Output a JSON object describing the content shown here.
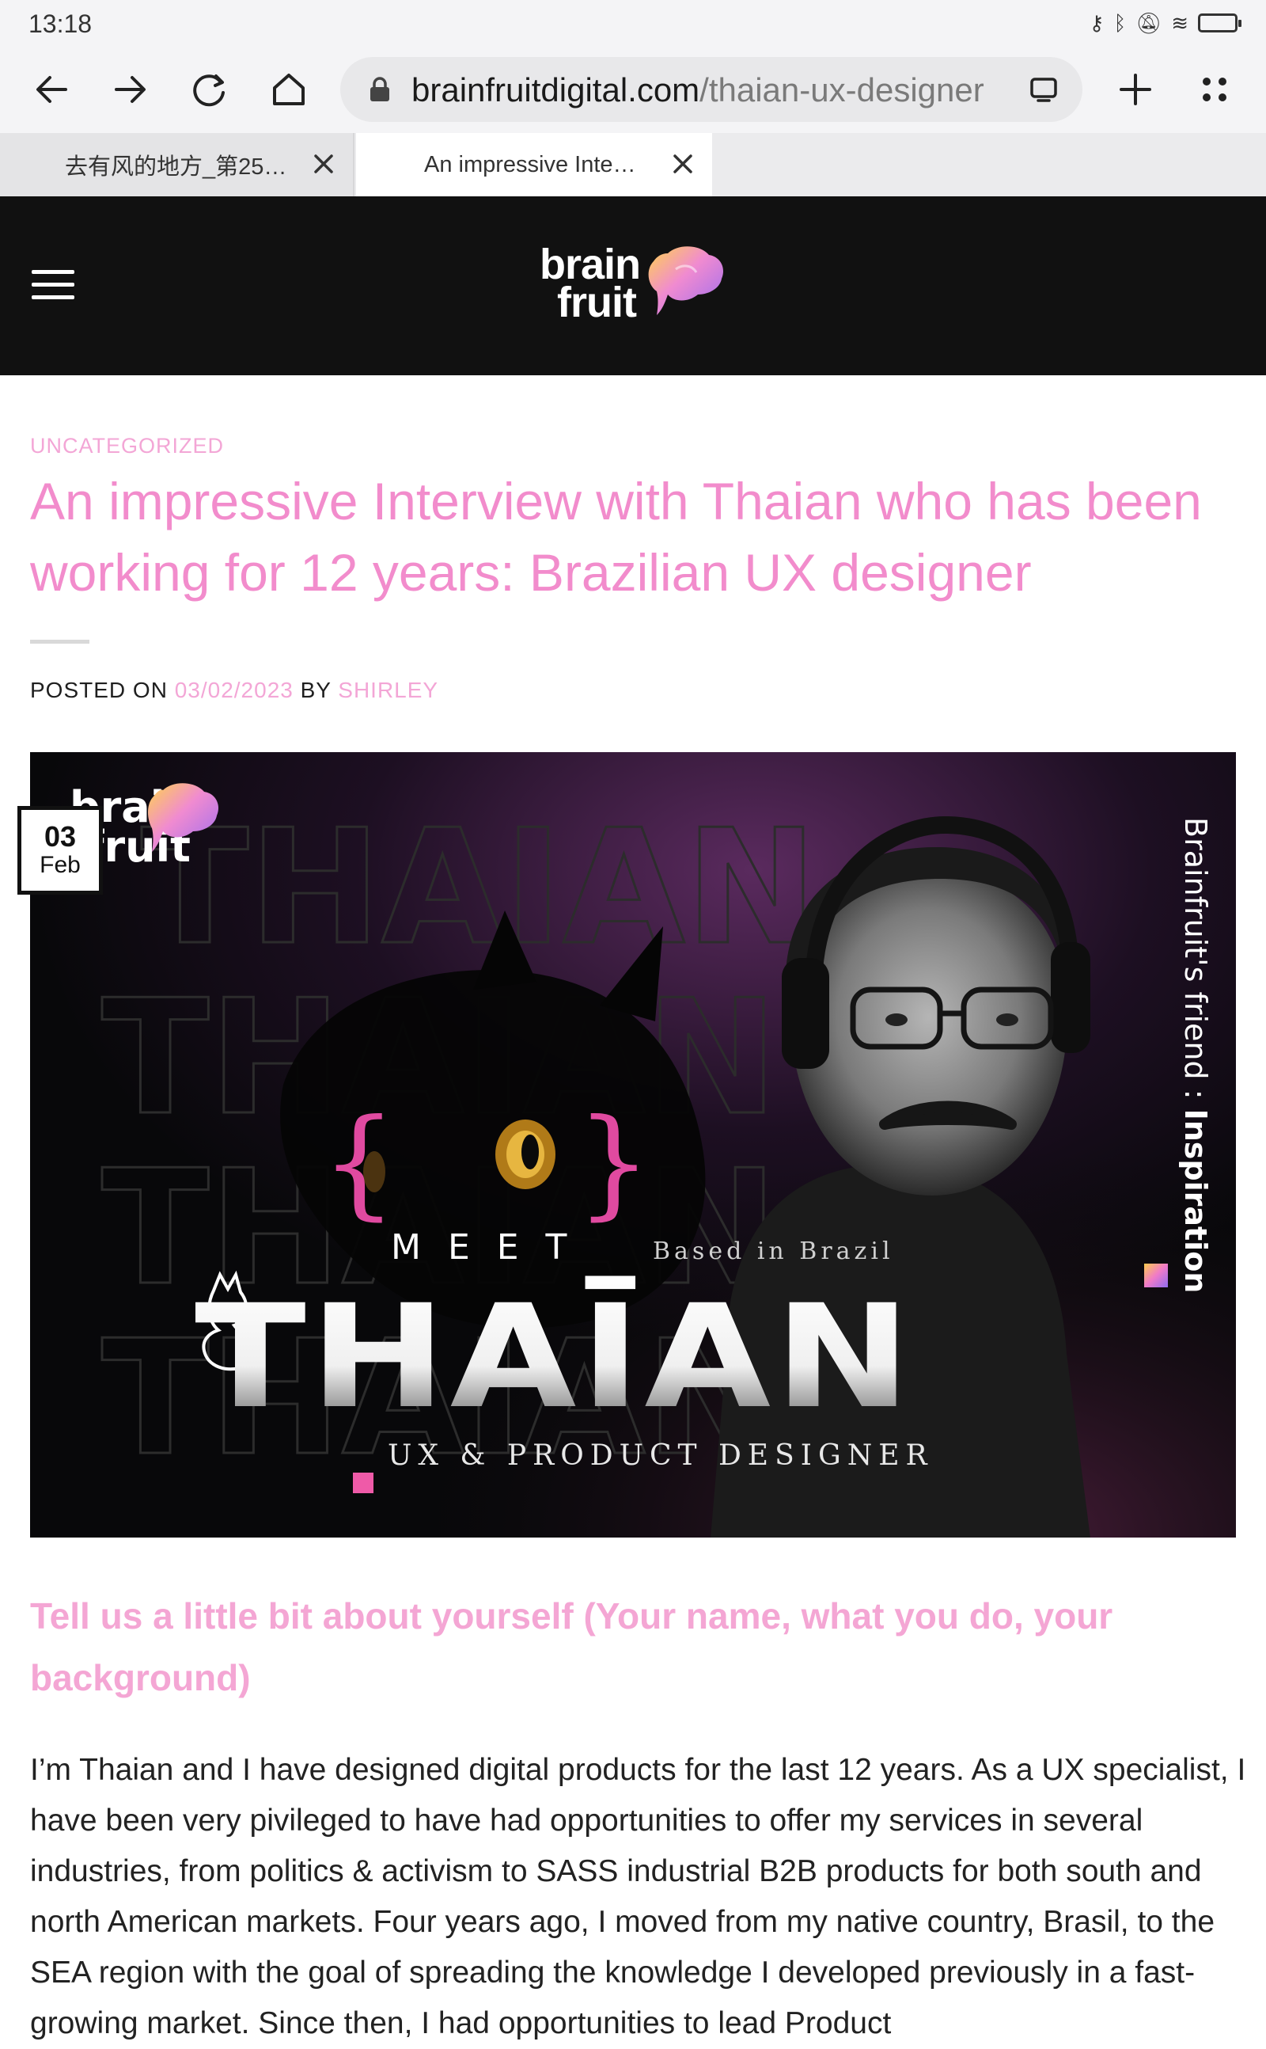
{
  "status": {
    "time": "13:18",
    "icons": [
      "key-icon",
      "bluetooth-icon",
      "mute-icon",
      "wifi-icon",
      "battery-icon"
    ]
  },
  "browser": {
    "url_domain": "brainfruitdigital.com",
    "url_path": "/thaian-ux-designer",
    "tabs": [
      {
        "label": "去有风的地方_第25…"
      },
      {
        "label": "An impressive Inte…"
      }
    ]
  },
  "site": {
    "logo_line1": "brain",
    "logo_line2": "fruit"
  },
  "article": {
    "category": "UNCATEGORIZED",
    "title": "An impressive Interview with Thaian who has been working for 12 years:  Brazilian UX designer",
    "posted_on": "POSTED ON",
    "date": "03/02/2023",
    "by": "BY",
    "author": "SHIRLEY"
  },
  "hero": {
    "badge_day": "03",
    "badge_month": "Feb",
    "bg_word": "THAIAN",
    "meet": "M E E T",
    "based": "Based in Brazil",
    "name": "THAĪAN",
    "role": "UX & PRODUCT DESIGNER",
    "side_text_a": "Brainfruit's friend : ",
    "side_text_b": "Inspiration",
    "logo_line1": "brain",
    "logo_line2": "fruit"
  },
  "section": {
    "heading": "Tell us a little bit about yourself (Your name, what you do, your background)",
    "paragraph": "I’m Thaian and I have designed digital products for the last 12 years. As a UX specialist, I have been very pivileged to have had opportunities to offer my services in several industries, from politics & activism to SASS industrial B2B products for both south and north American markets. Four years ago, I moved from my native country, Brasil, to the SEA region with the goal of spreading the knowledge I developed previously in a fast-growing market. Since then, I had opportunities to lead Product"
  },
  "colors": {
    "accent_pink": "#f28ccc",
    "header_bg": "#111111"
  }
}
